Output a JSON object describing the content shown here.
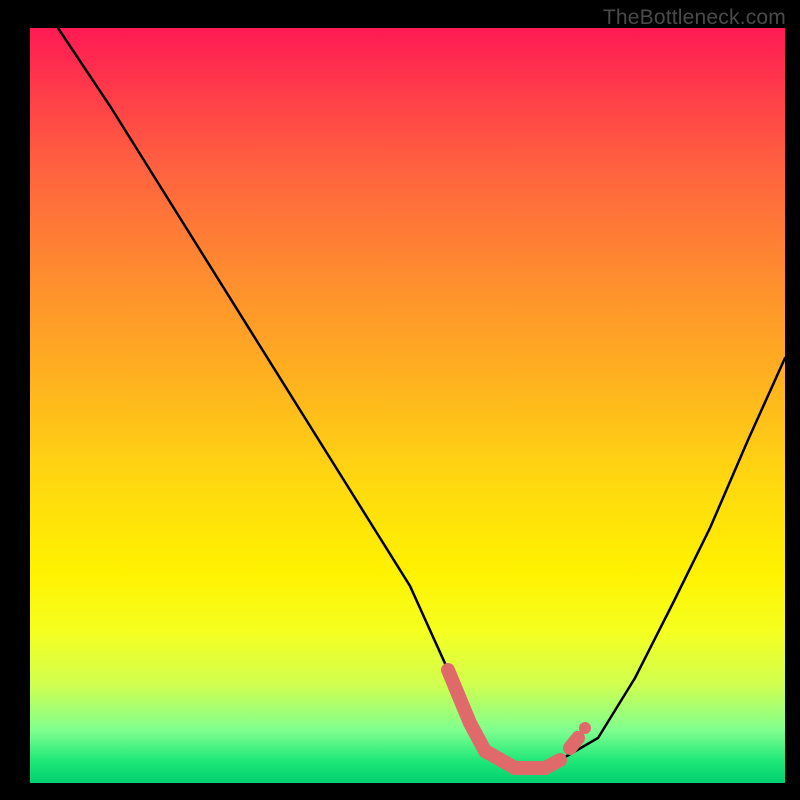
{
  "watermark": "TheBottleneck.com",
  "chart_data": {
    "type": "line",
    "title": "",
    "xlabel": "",
    "ylabel": "",
    "xlim": [
      0,
      100
    ],
    "ylim": [
      0,
      100
    ],
    "series": [
      {
        "name": "bottleneck-curve",
        "x": [
          4,
          10,
          20,
          30,
          40,
          50,
          55,
          58,
          60,
          64,
          68,
          70,
          75,
          80,
          85,
          90,
          95,
          100
        ],
        "y": [
          100,
          90,
          74,
          58,
          42,
          26,
          15,
          8,
          4,
          2,
          2,
          3,
          6,
          14,
          24,
          34,
          46,
          56
        ]
      }
    ],
    "annotations": [
      {
        "name": "optimal-range-marker",
        "x_start": 55,
        "x_end": 70,
        "y": 3
      }
    ],
    "background_gradient": {
      "top": "#ff1a54",
      "mid": "#fff200",
      "bottom": "#00d070"
    }
  }
}
